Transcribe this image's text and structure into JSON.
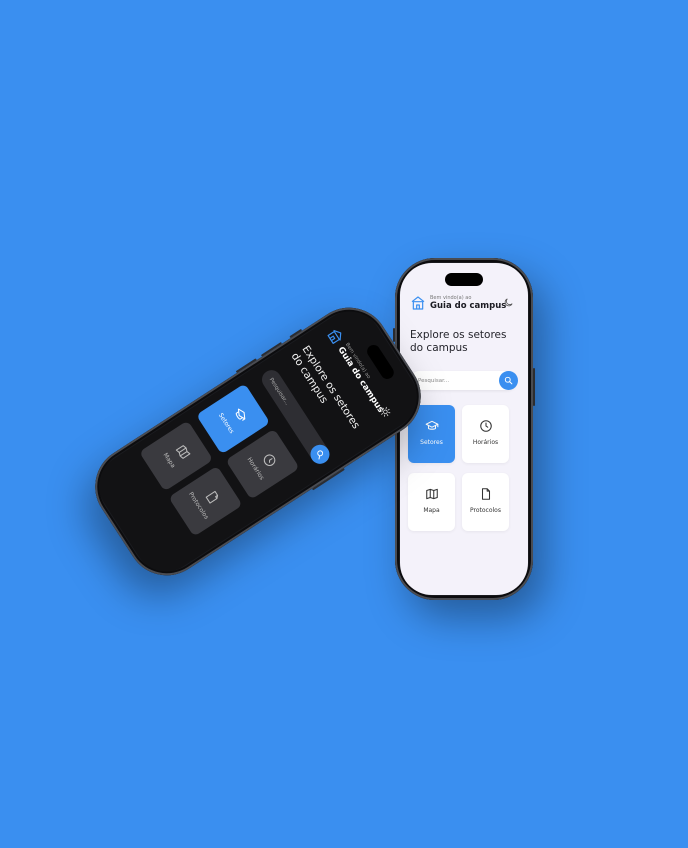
{
  "app": {
    "welcome": "Bem vindo(a) ao",
    "name": "Guia do campus",
    "headline": "Explore os setores do campus",
    "search_placeholder": "Pesquisar...",
    "tiles": [
      {
        "label": "Setores",
        "icon": "graduation-cap-icon",
        "active": true
      },
      {
        "label": "Horários",
        "icon": "clock-icon",
        "active": false
      },
      {
        "label": "Mapa",
        "icon": "map-icon",
        "active": false
      },
      {
        "label": "Protocolos",
        "icon": "document-icon",
        "active": false
      }
    ]
  },
  "colors": {
    "background": "#3a8ff0",
    "accent": "#3a8ff0",
    "light_screen": "#f4f2fa",
    "dark_screen": "#121214",
    "dark_tile": "#3a3a3f"
  },
  "phones": [
    {
      "theme": "light",
      "mode_icon": "moon-icon"
    },
    {
      "theme": "dark",
      "mode_icon": "sun-icon"
    }
  ]
}
